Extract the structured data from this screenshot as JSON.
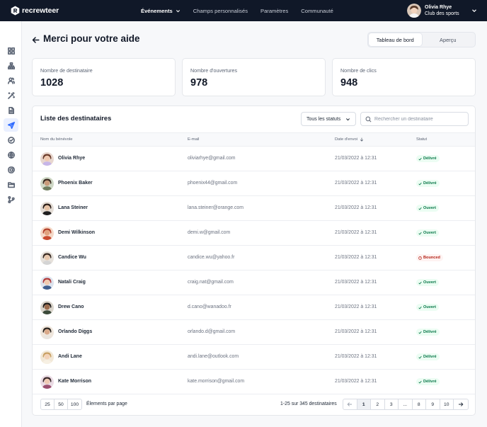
{
  "brand": {
    "name": "recrewteer",
    "icon": "recrewteer-logo-icon"
  },
  "nav": {
    "active": "Événements",
    "links": [
      "Champs personnalisés",
      "Paramètres",
      "Communauté"
    ]
  },
  "user": {
    "name": "Olivia Rhye",
    "subtitle": "Club des sports"
  },
  "sidebar": {
    "items": [
      {
        "icon": "dashboard-grid-icon"
      },
      {
        "icon": "org-chart-icon"
      },
      {
        "icon": "users-icon"
      },
      {
        "icon": "magic-wand-icon"
      },
      {
        "icon": "document-icon"
      },
      {
        "icon": "send-icon",
        "active": true
      },
      {
        "icon": "check-circle-icon"
      },
      {
        "icon": "globe-icon"
      },
      {
        "icon": "at-sign-icon"
      },
      {
        "icon": "folder-icon"
      },
      {
        "icon": "git-branch-icon"
      }
    ]
  },
  "page": {
    "title": "Merci pour votre aide"
  },
  "view_toggle": {
    "options": [
      "Tableau de bord",
      "Aperçu"
    ],
    "selected": "Tableau de bord"
  },
  "stats": [
    {
      "label": "Nombre de destinataire",
      "value": "1028"
    },
    {
      "label": "Nombre d'ouvertures",
      "value": "978"
    },
    {
      "label": "Nombre de clics",
      "value": "948"
    }
  ],
  "table": {
    "title": "Liste des destinataires",
    "filter_label": "Tous les statuts",
    "search_placeholder": "Rechercher un destinataire",
    "columns": [
      "Nom du bénévole",
      "E-mail",
      "Date d'envoi",
      "Statut"
    ],
    "rows": [
      {
        "name": "Olivia Rhye",
        "email": "oliviarhye@gmail.com",
        "date": "21/03/2022 à 12:31",
        "status": "Délivré",
        "status_type": "ok"
      },
      {
        "name": "Phoenix Baker",
        "email": "phoenix44@gmail.com",
        "date": "21/03/2022 à 12:31",
        "status": "Délivré",
        "status_type": "ok"
      },
      {
        "name": "Lana Steiner",
        "email": "lana.steiner@orange.com",
        "date": "21/03/2022 à 12:31",
        "status": "Ouvert",
        "status_type": "ok"
      },
      {
        "name": "Demi Wilkinson",
        "email": "demi.w@gmail.com",
        "date": "21/03/2022 à 12:31",
        "status": "Ouvert",
        "status_type": "ok"
      },
      {
        "name": "Candice Wu",
        "email": "candice.wu@yahoo.fr",
        "date": "21/03/2022 à 12:31",
        "status": "Bounced",
        "status_type": "bad"
      },
      {
        "name": "Natali Craig",
        "email": "craig.nat@gmail.com",
        "date": "21/03/2022 à 12:31",
        "status": "Ouvert",
        "status_type": "ok"
      },
      {
        "name": "Drew Cano",
        "email": "d.cano@wanadoo.fr",
        "date": "21/03/2022 à 12:31",
        "status": "Ouvert",
        "status_type": "ok"
      },
      {
        "name": "Orlando Diggs",
        "email": "orlando.d@gmail.com",
        "date": "21/03/2022 à 12:31",
        "status": "Délivré",
        "status_type": "ok"
      },
      {
        "name": "Andi Lane",
        "email": "andi.lane@outlook.com",
        "date": "21/03/2022 à 12:31",
        "status": "Délivré",
        "status_type": "ok"
      },
      {
        "name": "Kate Morrison",
        "email": "kate.morrison@gmail.com",
        "date": "21/03/2022 à 12:31",
        "status": "Délivré",
        "status_type": "ok"
      }
    ]
  },
  "footer": {
    "page_sizes": [
      "25",
      "50",
      "100"
    ],
    "page_size_label": "Élements par page",
    "range_text": "1-25 sur 345 destinataires",
    "pages": [
      "1",
      "2",
      "3",
      "...",
      "8",
      "9",
      "10"
    ],
    "current_page": "1"
  },
  "colors": {
    "nav_bg": "#101828",
    "accent": "#2f6bff",
    "success": "#067647",
    "error": "#b42318"
  }
}
